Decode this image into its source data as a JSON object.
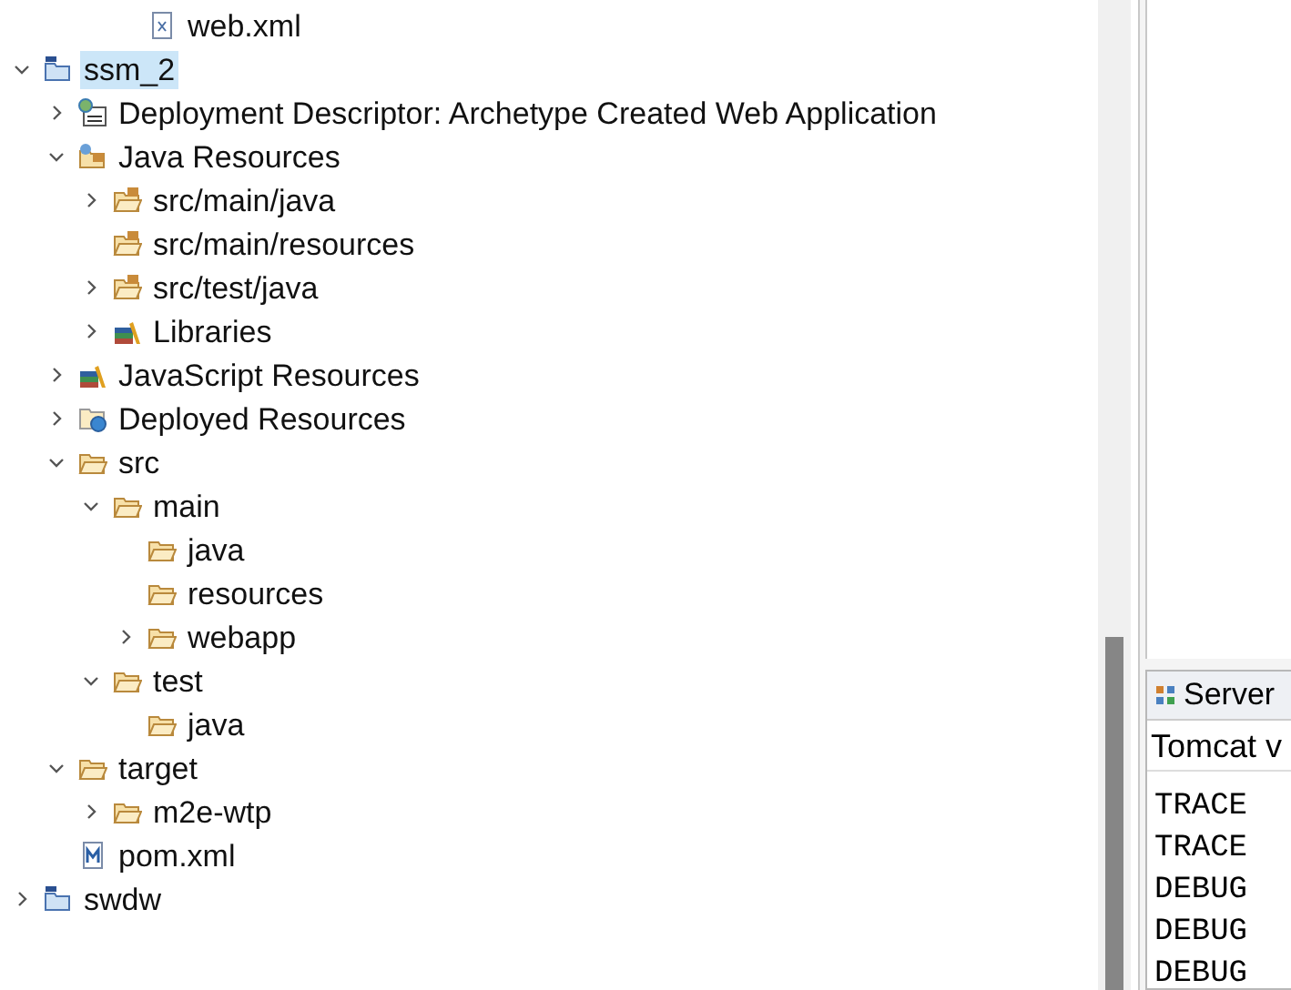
{
  "project_explorer": {
    "cut_top_item": {
      "label": "web.xml",
      "kind": "xml-file"
    },
    "tree": [
      {
        "label": "ssm_2",
        "kind": "project",
        "selected": true,
        "expanded": true,
        "children": [
          {
            "label": "Deployment Descriptor: Archetype Created Web Application",
            "kind": "descriptor",
            "selected": false,
            "expanded": false
          },
          {
            "label": "Java Resources",
            "kind": "java-resources",
            "selected": false,
            "expanded": true,
            "children": [
              {
                "label": "src/main/java",
                "kind": "package-folder",
                "selected": false,
                "expanded": false
              },
              {
                "label": "src/main/resources",
                "kind": "package-folder",
                "selected": false
              },
              {
                "label": "src/test/java",
                "kind": "package-folder",
                "selected": false,
                "expanded": false
              },
              {
                "label": "Libraries",
                "kind": "library",
                "selected": false,
                "expanded": false
              }
            ]
          },
          {
            "label": "JavaScript Resources",
            "kind": "library",
            "selected": false,
            "expanded": false
          },
          {
            "label": "Deployed Resources",
            "kind": "deployed",
            "selected": false,
            "expanded": false
          },
          {
            "label": "src",
            "kind": "folder",
            "selected": false,
            "expanded": true,
            "children": [
              {
                "label": "main",
                "kind": "folder",
                "selected": false,
                "expanded": true,
                "children": [
                  {
                    "label": "java",
                    "kind": "folder",
                    "selected": false
                  },
                  {
                    "label": "resources",
                    "kind": "folder",
                    "selected": false
                  },
                  {
                    "label": "webapp",
                    "kind": "folder",
                    "selected": false,
                    "expanded": false
                  }
                ]
              },
              {
                "label": "test",
                "kind": "folder",
                "selected": false,
                "expanded": true,
                "children": [
                  {
                    "label": "java",
                    "kind": "folder",
                    "selected": false
                  }
                ]
              }
            ]
          },
          {
            "label": "target",
            "kind": "folder",
            "selected": false,
            "expanded": true,
            "children": [
              {
                "label": "m2e-wtp",
                "kind": "folder",
                "selected": false,
                "expanded": false
              }
            ]
          },
          {
            "label": "pom.xml",
            "kind": "maven-file",
            "selected": false
          }
        ]
      },
      {
        "label": "swdw",
        "kind": "project",
        "selected": false,
        "expanded": false
      }
    ]
  },
  "servers_view": {
    "tab_label": "Server",
    "server_row": "Tomcat v",
    "console_lines": [
      "TRACE",
      "TRACE",
      "DEBUG",
      "DEBUG",
      "DEBUG"
    ]
  }
}
